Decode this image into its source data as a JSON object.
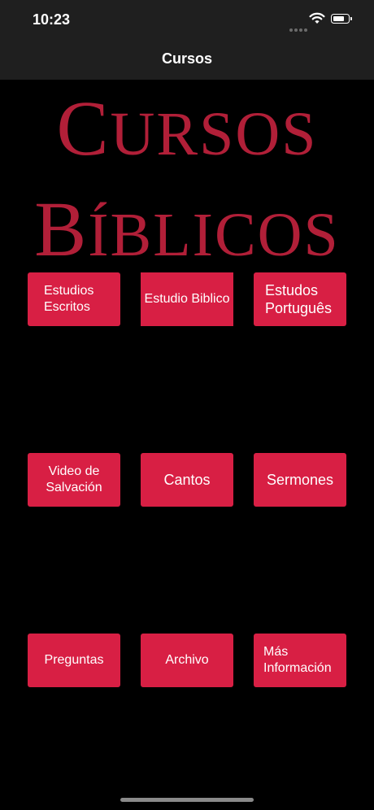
{
  "status_bar": {
    "time": "10:23"
  },
  "nav": {
    "title": "Cursos"
  },
  "logo": {
    "line1": {
      "first": "C",
      "rest": "URSOS"
    },
    "line2": {
      "first": "B",
      "rest": "ÍBLICOS"
    }
  },
  "tiles": [
    {
      "label_line1": "Estudios",
      "label_line2": "Escritos"
    },
    {
      "label": "Estudio Biblico"
    },
    {
      "label_line1": "Estudos",
      "label_line2": "Português"
    },
    {
      "label_line1": "Video de",
      "label_line2": "Salvación"
    },
    {
      "label": "Cantos"
    },
    {
      "label": "Sermones"
    },
    {
      "label": "Preguntas"
    },
    {
      "label": "Archivo"
    },
    {
      "label_line1": "Más",
      "label_line2": "Información"
    }
  ],
  "colors": {
    "tile": "#d81f44",
    "logo": "#b11f38",
    "bars": "#1f1f1f"
  }
}
